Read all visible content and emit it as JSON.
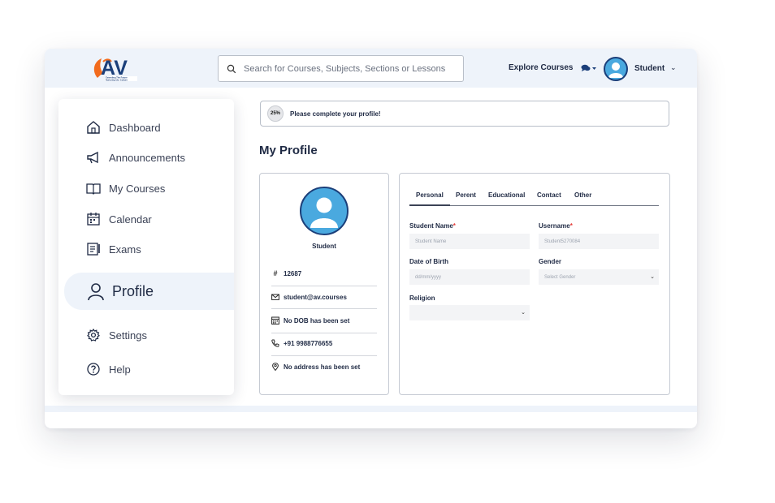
{
  "header": {
    "logo": {
      "text": "AV",
      "tagline1": "Extending The Future",
      "tagline2": "Nurturing Our Culture"
    },
    "search_placeholder": "Search for Courses, Subjects, Sections or Lessons",
    "explore_label": "Explore Courses",
    "chat_icon": "chat-icon",
    "user_name": "Student",
    "user_caret": "⌄"
  },
  "sidebar": {
    "items": [
      {
        "label": "Dashboard",
        "icon": "home-icon"
      },
      {
        "label": "Announcements",
        "icon": "megaphone-icon"
      },
      {
        "label": "My Courses",
        "icon": "book-icon"
      },
      {
        "label": "Calendar",
        "icon": "calendar-icon"
      },
      {
        "label": "Exams",
        "icon": "exam-icon"
      },
      {
        "label": "Profile",
        "icon": "user-icon",
        "active": true
      },
      {
        "label": "Settings",
        "icon": "gear-icon"
      },
      {
        "label": "Help",
        "icon": "help-icon"
      }
    ]
  },
  "banner": {
    "progress": "25%",
    "progress_value": 25,
    "message": "Please complete your profile!"
  },
  "page_title": "My Profile",
  "profile_card": {
    "name": "Student",
    "id": "12687",
    "email": "student@av.courses",
    "dob": "No DOB has been set",
    "phone": "+91 9988776655",
    "address": "No address has been set"
  },
  "tabs": [
    "Personal",
    "Perent",
    "Educational",
    "Contact",
    "Other"
  ],
  "form": {
    "student_name_label": "Student Name",
    "student_name_placeholder": "Student Name",
    "username_label": "Username",
    "username_placeholder": "Student5270084",
    "dob_label": "Date of Birth",
    "dob_placeholder": "dd/mm/yyyy",
    "gender_label": "Gender",
    "gender_placeholder": "Select Gender",
    "religion_label": "Religion",
    "required_mark": "*"
  },
  "colors": {
    "accent_navy": "#1b3f7a",
    "avatar_blue": "#4aa9df",
    "logo_orange": "#f26b1d",
    "topbar_bg": "#eef3fa"
  }
}
